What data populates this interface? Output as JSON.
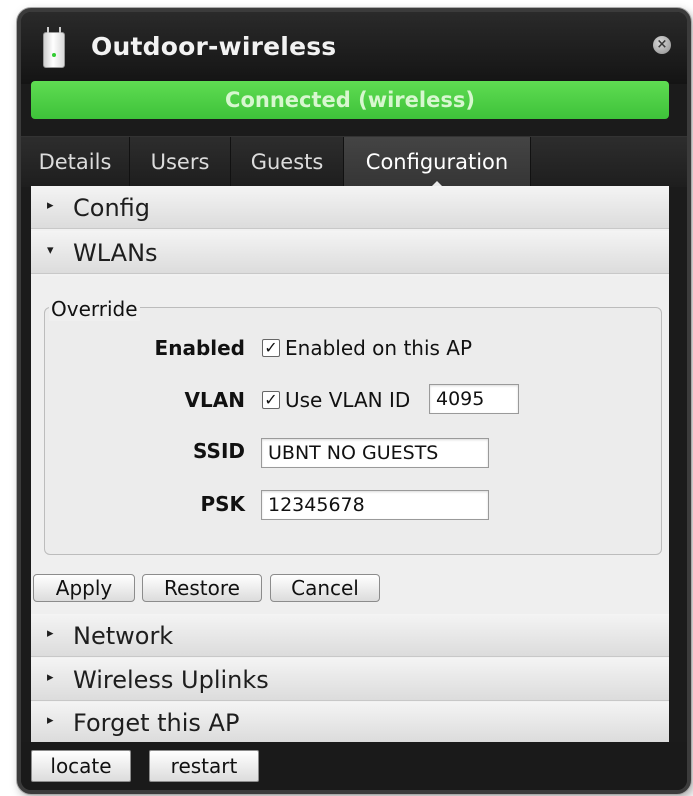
{
  "window": {
    "title": "Outdoor-wireless",
    "close_glyph": "×",
    "status": "Connected (wireless)"
  },
  "tabs": [
    {
      "label": "Details"
    },
    {
      "label": "Users"
    },
    {
      "label": "Guests"
    },
    {
      "label": "Configuration",
      "active": true
    }
  ],
  "sections": {
    "config": {
      "label": "Config",
      "expanded": false
    },
    "wlans": {
      "label": "WLANs",
      "expanded": true
    },
    "network": {
      "label": "Network",
      "expanded": false
    },
    "wireless_uplinks": {
      "label": "Wireless Uplinks",
      "expanded": false
    },
    "forget": {
      "label": "Forget this AP",
      "expanded": false
    }
  },
  "override": {
    "legend": "Override",
    "enabled": {
      "label": "Enabled",
      "checkbox_label": "Enabled on this AP",
      "checked": true
    },
    "vlan": {
      "label": "VLAN",
      "checkbox_label": "Use VLAN ID",
      "checked": true,
      "value": "4095"
    },
    "ssid": {
      "label": "SSID",
      "value": "UBNT NO GUESTS"
    },
    "psk": {
      "label": "PSK",
      "value": "12345678"
    }
  },
  "buttons": {
    "apply": "Apply",
    "restore": "Restore",
    "cancel": "Cancel",
    "locate": "locate",
    "restart": "restart"
  },
  "colors": {
    "status_green": "#4ccc44",
    "window_dark": "#1b1b1b"
  },
  "icons": {
    "collapsed": "▸",
    "expanded": "▾",
    "check": "✓",
    "device": "access-point-icon"
  }
}
